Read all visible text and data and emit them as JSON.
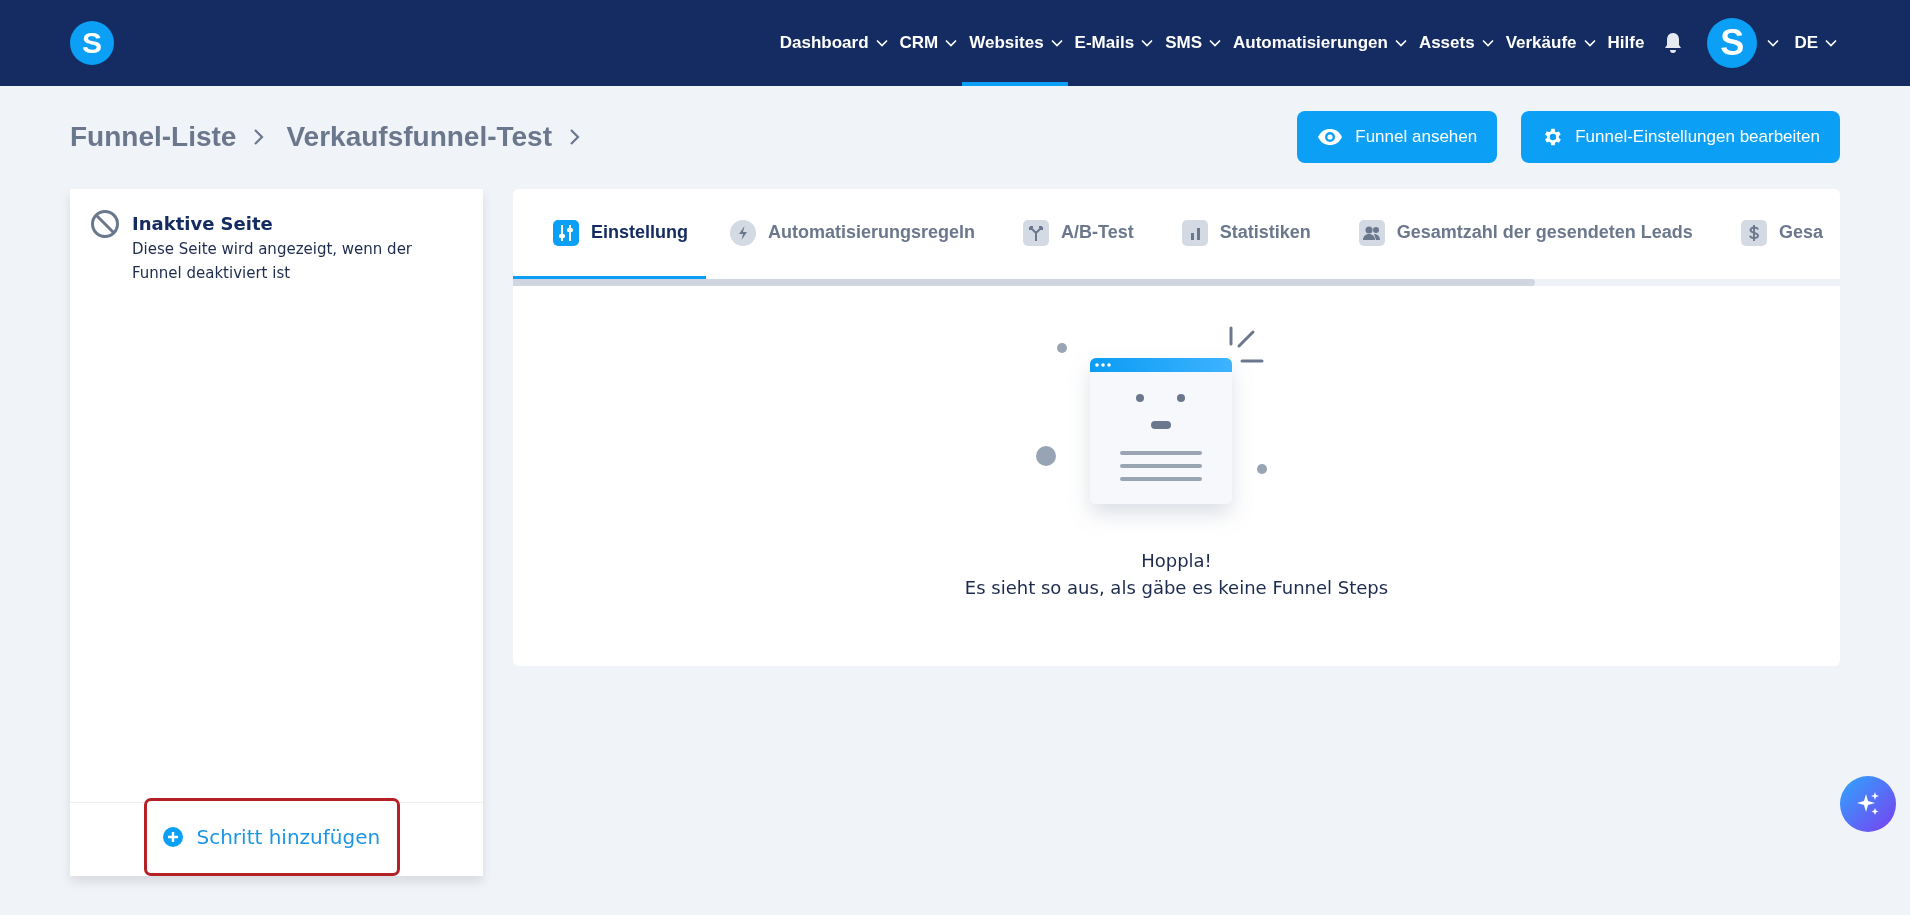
{
  "topbar": {
    "logo": "S",
    "nav": [
      {
        "label": "Dashboard",
        "dropdown": true,
        "selected": false
      },
      {
        "label": "CRM",
        "dropdown": true,
        "selected": false
      },
      {
        "label": "Websites",
        "dropdown": true,
        "selected": true
      },
      {
        "label": "E-Mails",
        "dropdown": true,
        "selected": false
      },
      {
        "label": "SMS",
        "dropdown": true,
        "selected": false
      },
      {
        "label": "Automatisierungen",
        "dropdown": true,
        "selected": false
      },
      {
        "label": "Assets",
        "dropdown": true,
        "selected": false
      },
      {
        "label": "Verkäufe",
        "dropdown": true,
        "selected": false
      },
      {
        "label": "Hilfe",
        "dropdown": false,
        "selected": false
      }
    ],
    "avatar": "S",
    "language": "DE"
  },
  "breadcrumb": [
    "Funnel-Liste",
    "Verkaufsfunnel-Test"
  ],
  "actions": [
    {
      "label": "Funnel ansehen",
      "kind": "eye"
    },
    {
      "label": "Funnel-Einstellungen bearbeiten",
      "kind": "gear"
    }
  ],
  "steps_panel": {
    "items": [
      {
        "title": "Inaktive Seite",
        "description": "Diese Seite wird angezeigt, wenn der Funnel deaktiviert ist"
      }
    ],
    "add_button": "Schritt hinzufügen",
    "highlighted": true
  },
  "tabs": [
    {
      "label": "Einstellung",
      "kind": "sliders",
      "selected": true
    },
    {
      "label": "Automatisierungsregeln",
      "kind": "bolt",
      "selected": false
    },
    {
      "label": "A/B-Test",
      "kind": "split",
      "selected": false
    },
    {
      "label": "Statistiken",
      "kind": "bars",
      "selected": false
    },
    {
      "label": "Gesamtzahl der gesendeten Leads",
      "kind": "people",
      "selected": false
    },
    {
      "label": "Gesa",
      "kind": "dollar",
      "selected": false
    }
  ],
  "empty_state": {
    "title": "Hoppla!",
    "message": "Es sieht so aus, als gäbe es keine Funnel Steps"
  }
}
